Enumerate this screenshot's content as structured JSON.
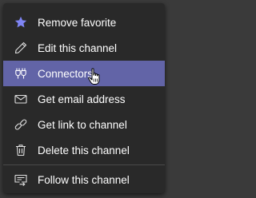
{
  "menu": {
    "items": [
      {
        "label": "Remove favorite",
        "icon": "star-icon"
      },
      {
        "label": "Edit this channel",
        "icon": "pencil-icon"
      },
      {
        "label": "Connectors",
        "icon": "connectors-icon"
      },
      {
        "label": "Get email address",
        "icon": "envelope-icon"
      },
      {
        "label": "Get link to channel",
        "icon": "link-icon"
      },
      {
        "label": "Delete this channel",
        "icon": "trash-icon"
      },
      {
        "label": "Follow this channel",
        "icon": "follow-icon"
      }
    ]
  },
  "colors": {
    "highlight": "#6264a7",
    "accent_star": "#7f85f5",
    "menu_bg": "#292929"
  }
}
